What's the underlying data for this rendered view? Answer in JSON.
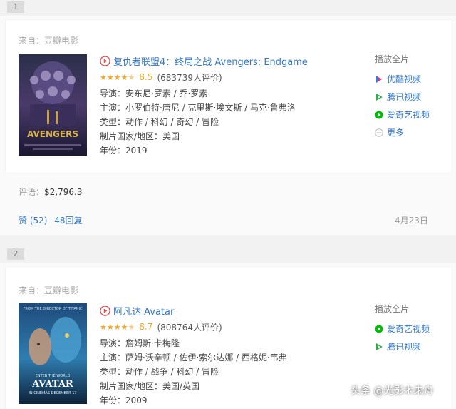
{
  "results": [
    {
      "rank": "1",
      "source": "来自：豆瓣电影",
      "title": "复仇者联盟4：终局之战 Avengers: Endgame",
      "rating": 8.5,
      "stars_filled": 4.5,
      "score": "8.5",
      "votes": "(683739人评价)",
      "director": "导演：安东尼·罗素 / 乔·罗素",
      "cast": "主演：小罗伯特·唐尼 / 克里斯·埃文斯 / 马克·鲁弗洛",
      "genre": "类型：动作 / 科幻 / 奇幻 / 冒险",
      "country": "制片国家/地区：美国",
      "year": "年份：2019",
      "play_label": "播放全片",
      "platforms": [
        "优酷视频",
        "腾讯视频",
        "爱奇艺视频",
        "更多"
      ],
      "comment_label": "评语：",
      "comment_value": "$2,796.3",
      "likes": "赞 (52)",
      "replies": "48回复",
      "date": "4月23日",
      "poster_colors": {
        "top": "#2b2f4a",
        "mid": "#4a3a6a",
        "bottom": "#1a1830",
        "accent": "#c9a24a"
      }
    },
    {
      "rank": "2",
      "source": "来自：豆瓣电影",
      "title": "阿凡达 Avatar",
      "rating": 8.7,
      "stars_filled": 4.5,
      "score": "8.7",
      "votes": "(808764人评价)",
      "director": "导演：詹姆斯·卡梅隆",
      "cast": "主演：萨姆·沃辛顿 / 佐伊·索尔达娜 / 西格妮·韦弗",
      "genre": "类型：动作 / 战争 / 科幻 / 冒险",
      "country": "制片国家/地区：美国/英国",
      "year": "年份：2009",
      "play_label": "播放全片",
      "platforms": [
        "爱奇艺视频",
        "腾讯视频"
      ],
      "poster_colors": {
        "top": "#1e4a7a",
        "mid": "#2f7db0",
        "bottom": "#0d2238",
        "accent": "#5fd0f0"
      }
    }
  ],
  "poster_text": {
    "avengers": "AVENGERS",
    "avatar_tag": "FROM THE DIRECTOR OF TITANIC",
    "avatar_enter": "ENTER THE WORLD",
    "avatar_title": "AVATAR",
    "avatar_date": "IN CINEMAS DECEMBER 17"
  },
  "watermark": "头条 @光影木未舟",
  "colors": {
    "link": "#3377cc",
    "star": "#f5a623",
    "youku": "#e83a6b",
    "tencent": "#2fb14a",
    "iqiyi": "#00be06"
  }
}
